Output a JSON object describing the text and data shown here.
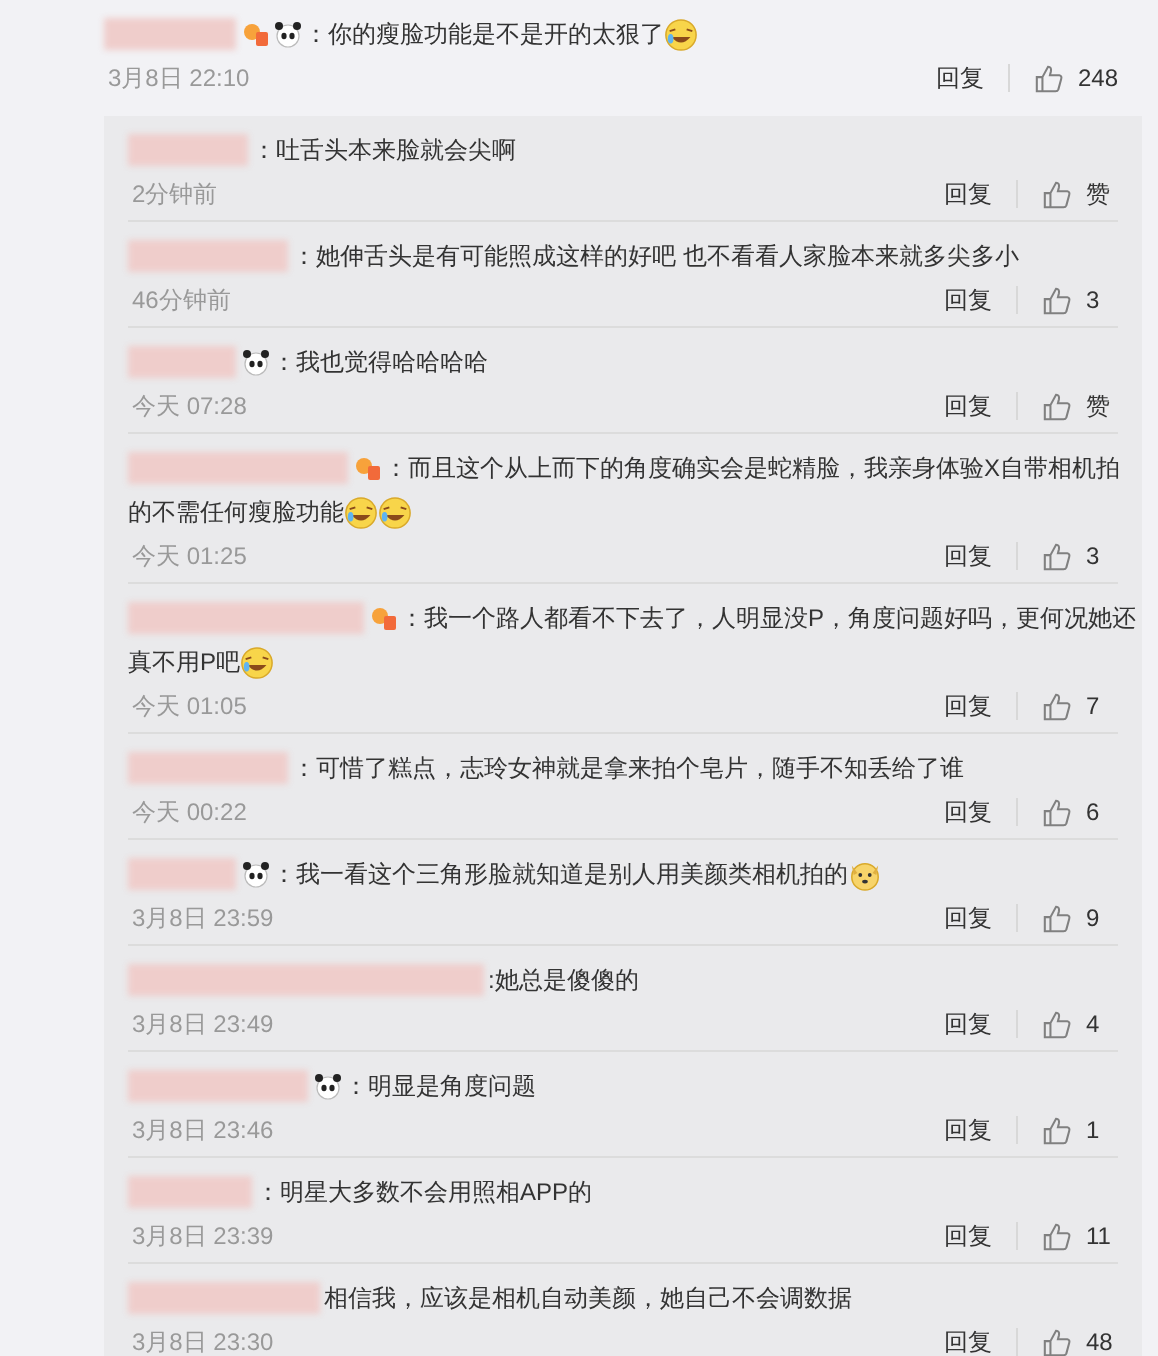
{
  "comment": {
    "badges": [
      {
        "kind": "vip"
      },
      {
        "kind": "panda"
      }
    ],
    "lines": [
      "：你的瘦脸功能是不是开的太狠了"
    ],
    "emojis": [
      {
        "kind": "laugh"
      }
    ],
    "time": "3月8日 22:10",
    "reply": "回复",
    "likes": "248"
  },
  "replies": [
    {
      "lines": [
        "：吐舌头本来脸就会尖啊"
      ],
      "time": "2分钟前",
      "reply": "回复",
      "likes": "赞"
    },
    {
      "lines": [
        "：她伸舌头是有可能照成这样的好吧 也不看看人家脸本来就多尖多小"
      ],
      "time": "46分钟前",
      "reply": "回复",
      "likes": "3"
    },
    {
      "badges": [
        {
          "kind": "panda"
        }
      ],
      "lines": [
        "：我也觉得哈哈哈哈"
      ],
      "time": "今天 07:28",
      "reply": "回复",
      "likes": "赞"
    },
    {
      "badges": [
        {
          "kind": "vip"
        }
      ],
      "lines": [
        "：而且这个从上而下的角度确实会是蛇精脸，我亲身体验X自带相机拍",
        "的不需任何瘦脸功能"
      ],
      "emojis": [
        {
          "kind": "laugh"
        },
        {
          "kind": "laugh"
        }
      ],
      "time": "今天 01:25",
      "reply": "回复",
      "likes": "3"
    },
    {
      "badges": [
        {
          "kind": "vip"
        }
      ],
      "lines": [
        "：我一个路人都看不下去了，人明显没P，角度问题好吗，更何况她还",
        "真不用P吧"
      ],
      "emojis": [
        {
          "kind": "laugh"
        }
      ],
      "time": "今天 01:05",
      "reply": "回复",
      "likes": "7"
    },
    {
      "lines": [
        "：可惜了糕点，志玲女神就是拿来拍个皂片，随手不知丢给了谁"
      ],
      "time": "今天 00:22",
      "reply": "回复",
      "likes": "6"
    },
    {
      "badges": [
        {
          "kind": "panda"
        }
      ],
      "lines": [
        "：我一看这个三角形脸就知道是别人用美颜类相机拍的"
      ],
      "emojis": [
        {
          "kind": "dog"
        }
      ],
      "time": "3月8日 23:59",
      "reply": "回复",
      "likes": "9"
    },
    {
      "lines": [
        ":她总是傻傻的"
      ],
      "time": "3月8日 23:49",
      "reply": "回复",
      "likes": "4"
    },
    {
      "badges": [
        {
          "kind": "panda"
        }
      ],
      "lines": [
        "：明显是角度问题"
      ],
      "time": "3月8日 23:46",
      "reply": "回复",
      "likes": "1"
    },
    {
      "lines": [
        "：明星大多数不会用照相APP的"
      ],
      "time": "3月8日 23:39",
      "reply": "回复",
      "likes": "11"
    },
    {
      "lines": [
        "相信我，应该是相机自动美颜，她自己不会调数据"
      ],
      "time": "3月8日 23:30",
      "reply": "回复",
      "likes": "48"
    }
  ]
}
